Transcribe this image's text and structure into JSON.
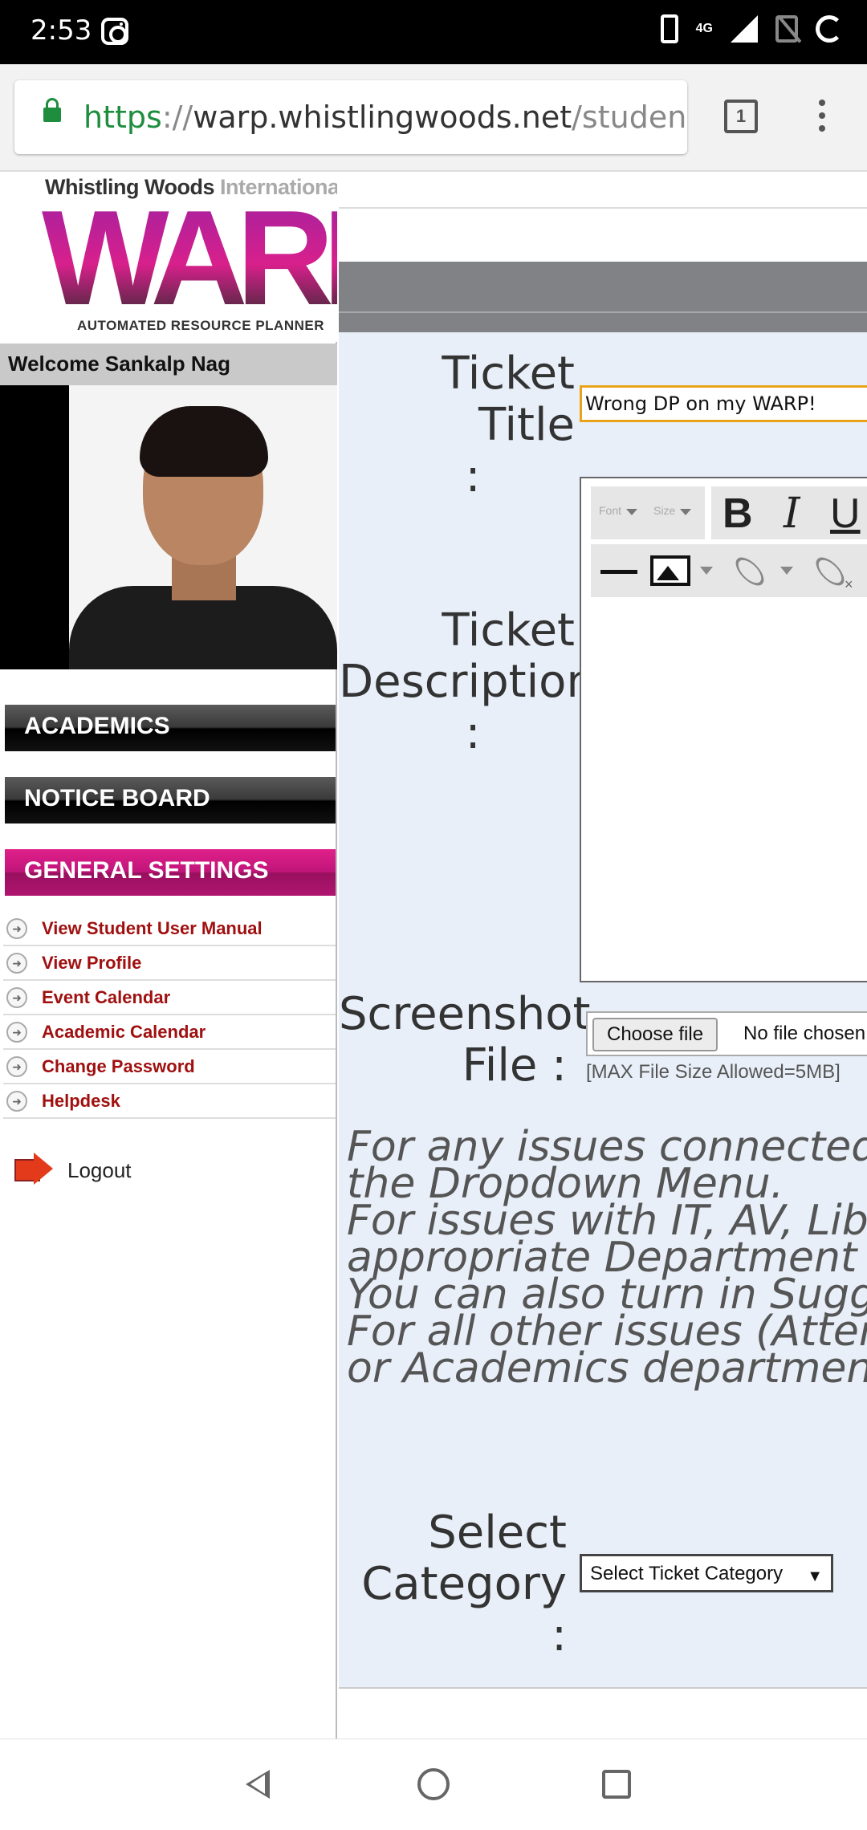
{
  "status_bar": {
    "time": "2:53",
    "network": "4G"
  },
  "browser": {
    "url_scheme": "https",
    "url_sep": "://",
    "url_host": "warp.whistlingwoods.net",
    "url_path": "/student/hc",
    "tab_count": "1"
  },
  "sidebar": {
    "logo_line1": "Whistling Woods ",
    "logo_line1_tail": "International",
    "logo_main": "WARP",
    "logo_tagline": "AUTOMATED RESOURCE PLANNER",
    "welcome": "Welcome Sankalp Nag",
    "nav": {
      "academics": "ACADEMICS",
      "notice_board": "NOTICE BOARD",
      "general_settings": "GENERAL SETTINGS"
    },
    "items": [
      {
        "label": "View Student User Manual"
      },
      {
        "label": "View Profile"
      },
      {
        "label": "Event Calendar"
      },
      {
        "label": "Academic Calendar"
      },
      {
        "label": "Change Password"
      },
      {
        "label": "Helpdesk"
      }
    ],
    "logout": "Logout"
  },
  "form": {
    "ticket_title_label_1": "Ticket Title",
    "ticket_title_label_2": ":",
    "ticket_title_value": "Wrong DP on my WARP!",
    "ticket_desc_label_1": "Ticket",
    "ticket_desc_label_2": "Description",
    "ticket_desc_label_3": ":",
    "editor": {
      "font_dropdown": "Font",
      "size_dropdown": "Size",
      "bold": "B",
      "italic": "I",
      "underline": "U"
    },
    "screenshot_label_1": "Screenshot",
    "screenshot_label_2": "File :",
    "choose_file": "Choose file",
    "file_status": "No file chosen",
    "max_size": "[MAX File Size Allowed=5MB]",
    "info_lines": [
      "For any issues connected w",
      "the Dropdown Menu.",
      "For issues with IT, AV, Librar",
      "appropriate Department fro",
      "You can also turn in Sugges",
      "For all other issues (Attenda",
      "or Academics department c"
    ],
    "category_label_1": "Select",
    "category_label_2": "Category :",
    "category_select": "Select Ticket Category"
  }
}
